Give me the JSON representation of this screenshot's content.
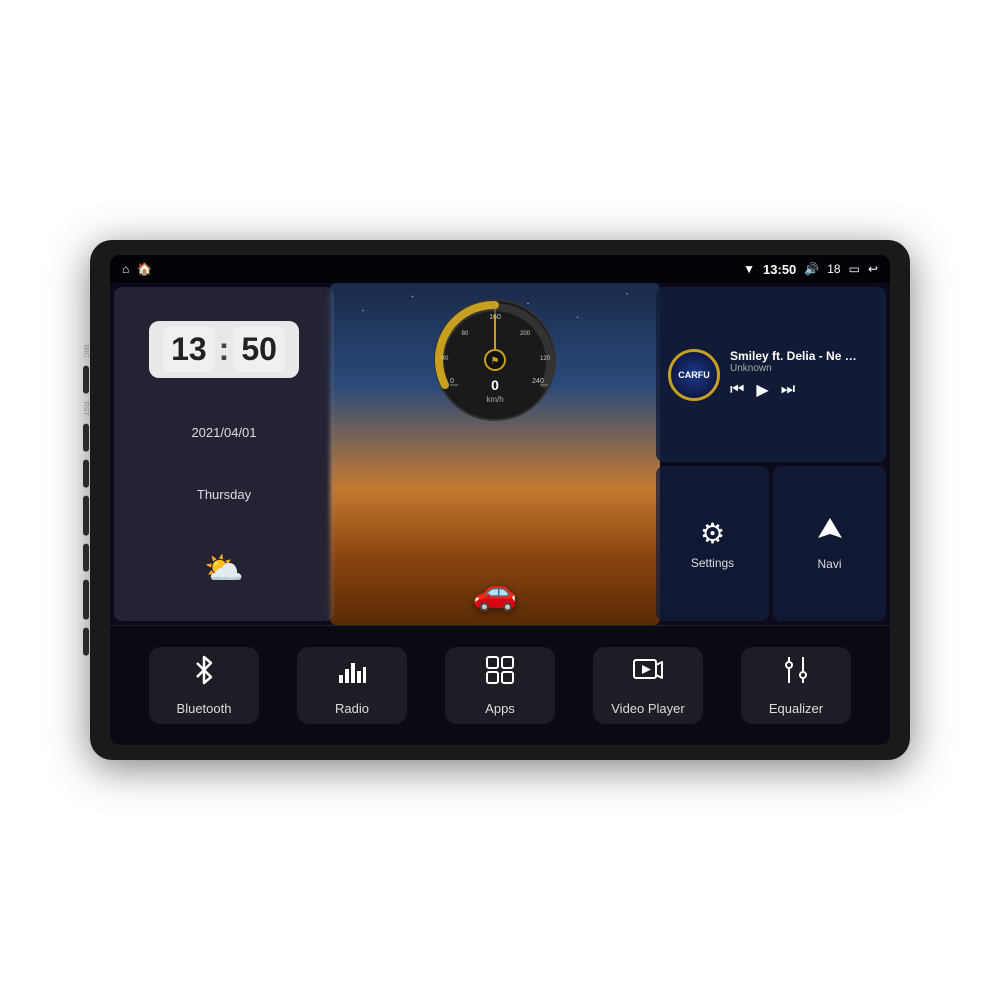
{
  "device": {
    "bg_color": "#1a1a1a"
  },
  "status_bar": {
    "time": "13:50",
    "volume": "18",
    "wifi_icon": "▼",
    "speaker_icon": "🔊",
    "battery_icon": "🔋",
    "back_icon": "↩",
    "home_icon": "⌂",
    "mic_label": "MIC",
    "rst_label": "RST"
  },
  "clock": {
    "hours": "13",
    "minutes": "50",
    "date": "2021/04/01",
    "day": "Thursday"
  },
  "speedometer": {
    "speed": "0",
    "unit": "km/h",
    "max": "240"
  },
  "music": {
    "title": "Smiley ft. Delia - Ne v...",
    "artist": "Unknown",
    "logo_text": "CARFU",
    "prev_icon": "⏮",
    "play_icon": "▶",
    "next_icon": "⏭"
  },
  "settings_panel": {
    "icon": "⚙",
    "label": "Settings"
  },
  "navi_panel": {
    "icon": "◬",
    "label": "Navi"
  },
  "dock": {
    "items": [
      {
        "id": "bluetooth",
        "icon": "bluetooth",
        "label": "Bluetooth"
      },
      {
        "id": "radio",
        "icon": "radio",
        "label": "Radio"
      },
      {
        "id": "apps",
        "icon": "apps",
        "label": "Apps"
      },
      {
        "id": "video-player",
        "icon": "video",
        "label": "Video Player"
      },
      {
        "id": "equalizer",
        "icon": "equalizer",
        "label": "Equalizer"
      }
    ]
  },
  "side_buttons": [
    "MIC",
    "RST",
    "",
    "",
    "",
    ""
  ]
}
